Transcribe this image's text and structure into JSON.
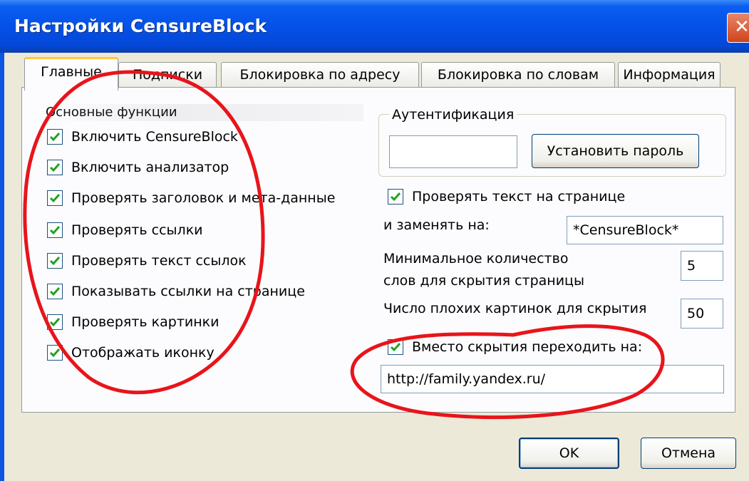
{
  "window": {
    "title": "Настройки CensureBlock",
    "close_symbol": "✕"
  },
  "tabs": [
    {
      "label": "Главные",
      "active": true
    },
    {
      "label": "Подписки",
      "active": false
    },
    {
      "label": "Блокировка по адресу",
      "active": false
    },
    {
      "label": "Блокировка по словам",
      "active": false
    },
    {
      "label": "Информация",
      "active": false
    }
  ],
  "main_functions": {
    "header": "Основные функции",
    "items": [
      {
        "label": "Включить CensureBlock",
        "checked": true
      },
      {
        "label": "Включить анализатор",
        "checked": true
      },
      {
        "label": "Проверять заголовок и мета-данные",
        "checked": true
      },
      {
        "label": "Проверять ссылки",
        "checked": true
      },
      {
        "label": "Проверять текст ссылок",
        "checked": true
      },
      {
        "label": "Показывать ссылки на странице",
        "checked": true
      },
      {
        "label": "Проверять картинки",
        "checked": true
      },
      {
        "label": "Отображать иконку",
        "checked": true
      }
    ]
  },
  "auth": {
    "group_label": "Аутентификация",
    "password_value": "",
    "set_password_label": "Установить пароль"
  },
  "text_check": {
    "checkbox_label": "Проверять текст на странице",
    "checked": true,
    "replace_label": "и заменять на:",
    "replace_value": "*CensureBlock*",
    "min_words_label_1": "Минимальное количество",
    "min_words_label_2": "слов для скрытия страницы",
    "min_words_value": "5",
    "bad_images_label": "Число плохих картинок для скрытия",
    "bad_images_value": "50"
  },
  "redirect": {
    "checkbox_label": "Вместо скрытия переходить на:",
    "checked": true,
    "url_value": "http://family.yandex.ru/"
  },
  "buttons": {
    "ok": "OK",
    "cancel": "Отмена"
  },
  "colors": {
    "titlebar": "#0551e8",
    "dialog_bg": "#ece9d8",
    "active_tab_accent": "#ffc83c",
    "check_mark": "#21a121",
    "annotation_red": "#e8141a"
  }
}
